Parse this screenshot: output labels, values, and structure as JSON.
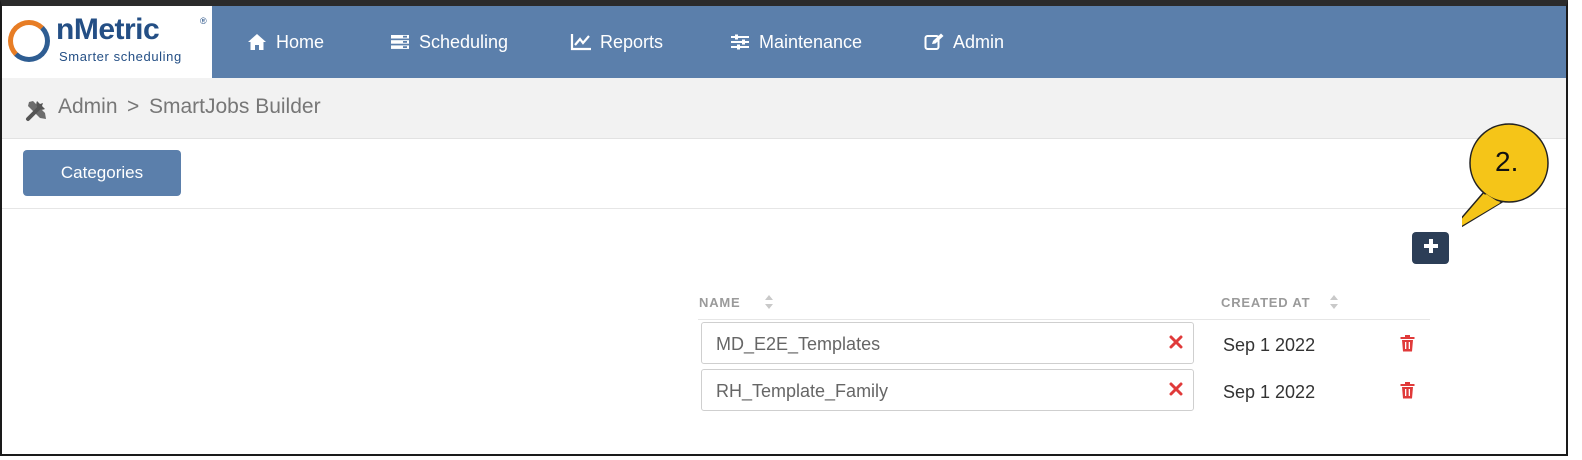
{
  "brand": {
    "name": "nMetric",
    "registered": "®",
    "tagline": "Smarter scheduling"
  },
  "nav": {
    "items": [
      {
        "label": "Home",
        "icon": "home-icon"
      },
      {
        "label": "Scheduling",
        "icon": "scheduling-icon"
      },
      {
        "label": "Reports",
        "icon": "chart-line-icon"
      },
      {
        "label": "Maintenance",
        "icon": "sliders-icon"
      },
      {
        "label": "Admin",
        "icon": "edit-icon"
      }
    ]
  },
  "breadcrumb": {
    "icon": "tools-icon",
    "items": [
      "Admin",
      "SmartJobs Builder"
    ],
    "separator": ">"
  },
  "toolbar": {
    "categories_label": "Categories",
    "add_icon": "plus-icon"
  },
  "callout": {
    "label": "2.",
    "color": "#f5c518"
  },
  "table": {
    "columns": [
      "NAME",
      "CREATED AT"
    ],
    "rows": [
      {
        "name": "MD_E2E_Templates",
        "created_at": "Sep 1 2022"
      },
      {
        "name": "RH_Template_Family",
        "created_at": "Sep 1 2022"
      }
    ]
  },
  "colors": {
    "nav_bg": "#5b7fab",
    "button_bg": "#5b7fab",
    "add_button_bg": "#2c3e57",
    "delete_red": "#e03a3a"
  }
}
